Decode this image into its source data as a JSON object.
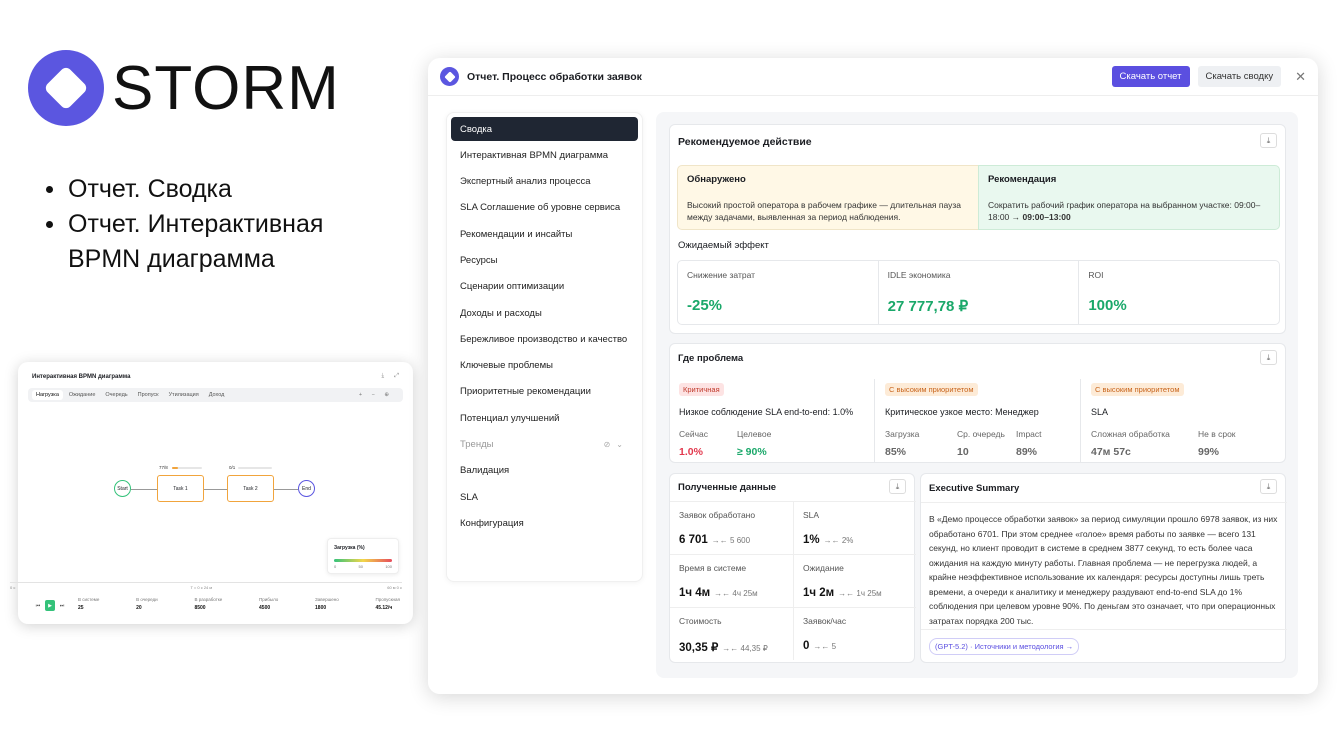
{
  "brand": {
    "name": "STORM"
  },
  "bullets": [
    "Отчет. Сводка",
    "Отчет. Интерактивная BPMN диаграмма"
  ],
  "mini": {
    "title": "Интерактивная BPMN диаграмма",
    "tabs": [
      "Нагрузка",
      "Ожидание",
      "Очередь",
      "Пропуск",
      "Утилизация",
      "Доход"
    ],
    "nodes": {
      "start": "Start",
      "task1": "Task 1",
      "task2": "Task 2",
      "end": "End",
      "task1_count": "77/8",
      "task2_count": "0/1"
    },
    "legend": {
      "title": "Загрузка (%)",
      "min": "0",
      "mid": "50",
      "max": "100"
    },
    "axis": {
      "left": "0 с",
      "center": "T = 0 с 24 м",
      "right": "60 м 0 с"
    },
    "stats": [
      {
        "label": "В системе",
        "value": "25"
      },
      {
        "label": "В очереди",
        "value": "20"
      },
      {
        "label": "В разработке",
        "value": "8500"
      },
      {
        "label": "Прибыло",
        "value": "4500"
      },
      {
        "label": "Завершено",
        "value": "1800"
      },
      {
        "label": "Пропускная",
        "value": "45.12/ч"
      }
    ]
  },
  "window": {
    "title": "Отчет. Процесс обработки заявок",
    "download_report": "Скачать отчет",
    "download_summary": "Скачать сводку",
    "close": "✕"
  },
  "nav": [
    "Сводка",
    "Интерактивная BPMN диаграмма",
    "Экспертный анализ процесса",
    "SLA Соглашение об уровне сервиса",
    "Рекомендации и инсайты",
    "Ресурсы",
    "Сценарии оптимизации",
    "Доходы и расходы",
    "Бережливое производство и качество",
    "Ключевые проблемы",
    "Приоритетные рекомендации",
    "Потенциал улучшений",
    "Тренды",
    "Валидация",
    "SLA",
    "Конфигурация"
  ],
  "recommended": {
    "title": "Рекомендуемое действие",
    "found_title": "Обнаружено",
    "found_text": "Высокий простой оператора в рабочем графике — длительная пауза между задачами, выявленная за период наблюдения.",
    "reco_title": "Рекомендация",
    "reco_text": "Сократить рабочий график оператора на выбранном участке: 09:00–18:00",
    "reco_bold": "→ 09:00–13:00",
    "effect_title": "Ожидаемый эффект",
    "metrics": [
      {
        "label": "Снижение затрат",
        "value": "-25%"
      },
      {
        "label": "IDLE экономика",
        "value": "27 777,78 ₽"
      },
      {
        "label": "ROI",
        "value": "100%"
      }
    ]
  },
  "problems": {
    "title": "Где проблема",
    "items": [
      {
        "badge": "Критичная",
        "title": "Низкое соблюдение SLA end-to-end: 1.0%",
        "m1l": "Сейчас",
        "m1v": "1.0%",
        "m2l": "Целевое",
        "m2v": "≥ 90%"
      },
      {
        "badge": "С высоким приоритетом",
        "title": "Критическое узкое место: Менеджер",
        "m1l": "Загрузка",
        "m1v": "85%",
        "m2l": "Ср. очередь",
        "m2v": "10",
        "m3l": "Impact",
        "m3v": "89%"
      },
      {
        "badge": "С высоким приоритетом",
        "title": "SLA",
        "m1l": "Сложная обработка",
        "m1v": "47м 57с",
        "m2l": "Не в срок",
        "m2v": "99%"
      }
    ]
  },
  "received": {
    "title": "Полученные данные",
    "cells": [
      {
        "label": "Заявок обработано",
        "value": "6 701",
        "prev": "5 600"
      },
      {
        "label": "SLA",
        "value": "1%",
        "prev": "2%"
      },
      {
        "label": "Время в системе",
        "value": "1ч 4м",
        "prev": "4ч 25м"
      },
      {
        "label": "Ожидание",
        "value": "1ч 2м",
        "prev": "1ч 25м"
      },
      {
        "label": "Стоимость",
        "value": "30,35 ₽",
        "prev": "44,35 ₽"
      },
      {
        "label": "Заявок/час",
        "value": "0",
        "prev": "5"
      }
    ]
  },
  "executive": {
    "title": "Executive Summary",
    "text": "В «Демо процессе обработки заявок» за период симуляции прошло 6978 заявок, из них обработано 6701. При этом среднее «голое» время работы по заявке — всего 131 секунд, но клиент проводит в системе в среднем 3877 секунд, то есть более часа ожидания на каждую минуту работы. Главная проблема — не перегрузка людей, а крайне неэффективное использование их календаря: ресурсы доступны лишь треть времени, а очереди к аналитику и менеджеру раздувают end-to-end SLA до 1% соблюдения при целевом уровне 90%. По деньгам это означает, что при операционных затратах порядка 200 тыс.",
    "source": "(GPT-5.2) · Источники и методология →"
  }
}
